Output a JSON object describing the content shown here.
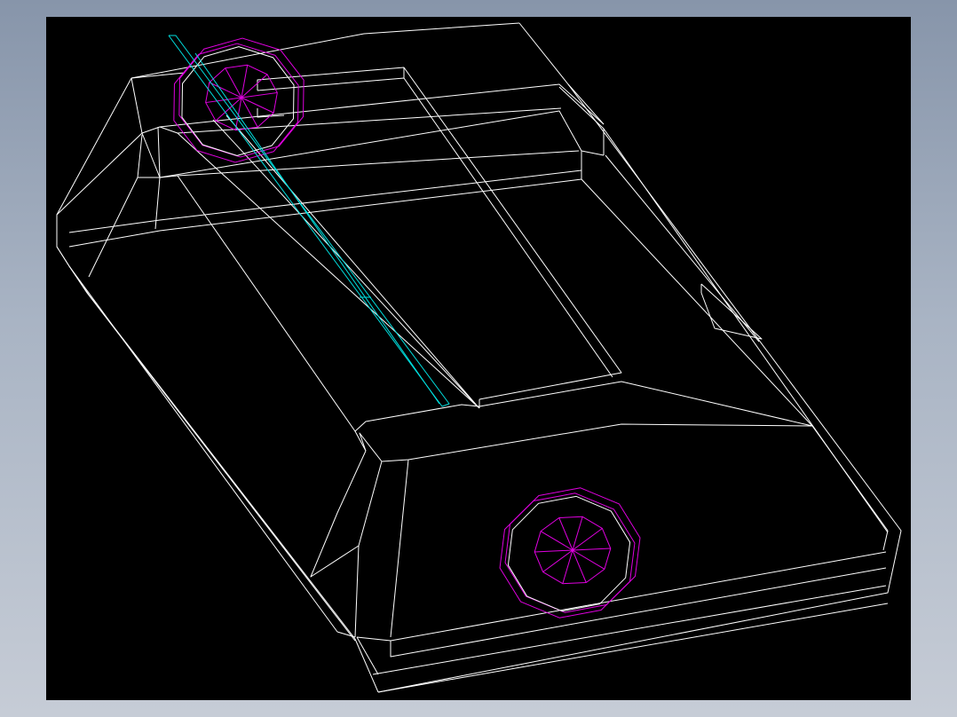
{
  "drawing": {
    "background_color": "#000000",
    "frame_color": "#9aa6b8",
    "colors": {
      "body_edges": "#ffffff",
      "holes": "#e000e0",
      "slot_line": "#00e0e0"
    }
  }
}
